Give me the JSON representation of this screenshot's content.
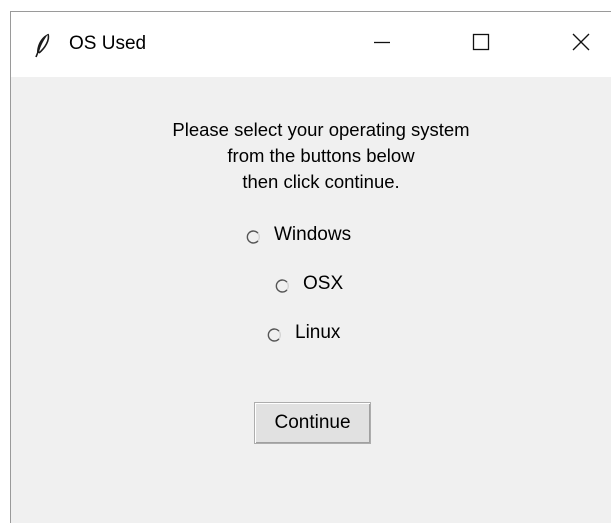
{
  "window": {
    "title": "OS Used",
    "icon": "feather-icon",
    "controls": [
      "minimize-icon",
      "maximize-icon",
      "close-icon"
    ]
  },
  "instructions": {
    "line1": "Please select your operating system",
    "line2": "from the buttons below",
    "line3": "then click continue."
  },
  "options": [
    {
      "label": "Windows",
      "selected": false
    },
    {
      "label": "OSX",
      "selected": false
    },
    {
      "label": "Linux",
      "selected": false
    }
  ],
  "continue_label": "Continue",
  "colors": {
    "window_bg": "#f0f0f0",
    "titlebar_bg": "#ffffff",
    "button_bg": "#e1e1e1"
  }
}
